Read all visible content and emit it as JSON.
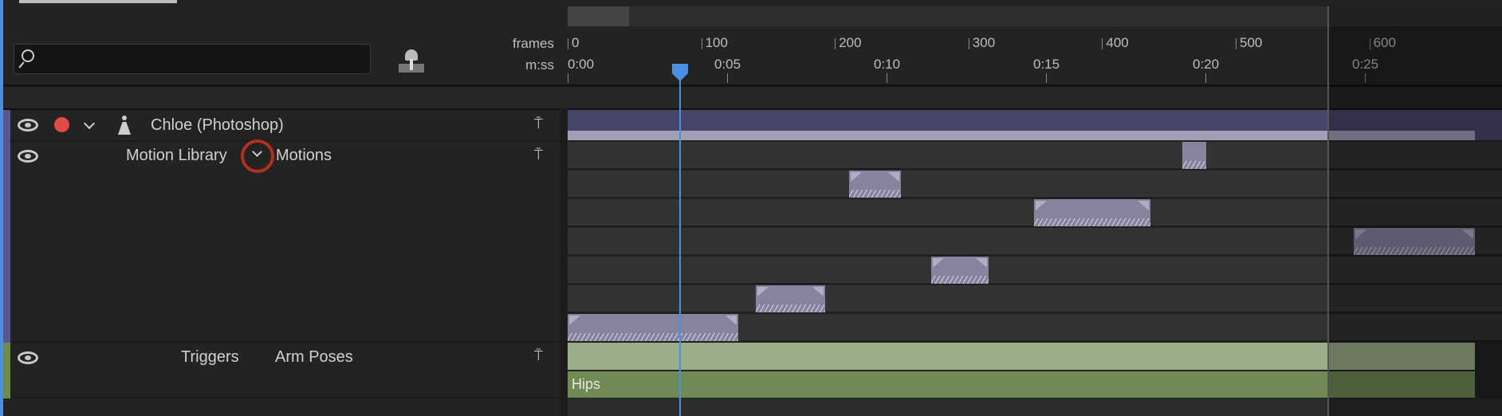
{
  "header": {
    "frames_label": "frames",
    "mss_label": "m:ss",
    "frame_ticks": [
      "0",
      "100",
      "200",
      "300",
      "400",
      "500",
      "600"
    ],
    "time_ticks": [
      "0:00",
      "0:05",
      "0:10",
      "0:15",
      "0:20",
      "0:25"
    ],
    "search": {
      "placeholder": "",
      "value": ""
    }
  },
  "tracks": [
    {
      "name": "Chloe (Photoshop)",
      "icon": "puppet-icon",
      "record_color": "#e04a47"
    },
    {
      "name": "Motion Library",
      "sub": "Motions"
    },
    {
      "name": "Triggers",
      "sub": "Arm Poses",
      "take": "Hips"
    }
  ],
  "colors": {
    "accent": "#4a90e2",
    "puppet_bar": "#48456a",
    "trigger_light": "#9bad88",
    "trigger_dark": "#6f8a55",
    "highlight_ring": "#b0301e"
  }
}
